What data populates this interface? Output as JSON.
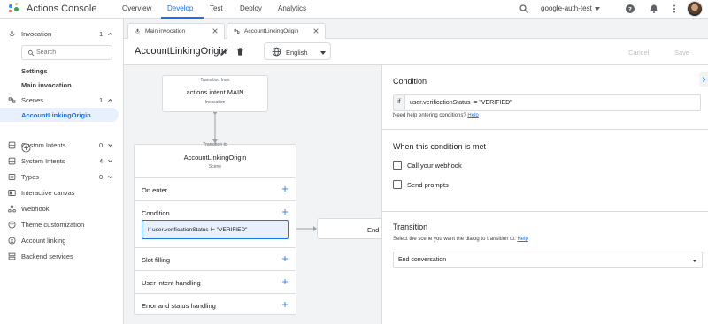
{
  "app": {
    "title": "Actions Console",
    "nav": [
      "Overview",
      "Develop",
      "Test",
      "Deploy",
      "Analytics"
    ],
    "active_nav": "Develop",
    "project": "google-auth-test",
    "colors": {
      "accent": "#1a73e8",
      "selected_bg": "#e8f0fe",
      "canvas_bg": "#f1f3f4"
    }
  },
  "sidebar": {
    "invocation": {
      "label": "Invocation",
      "count": "1"
    },
    "search_placeholder": "Search",
    "settings": "Settings",
    "main_invocation": "Main invocation",
    "scenes": {
      "label": "Scenes",
      "count": "1"
    },
    "scene_item": "AccountLinkingOrigin",
    "items": [
      {
        "label": "Custom Intents",
        "count": "0",
        "icon": "grid-icon"
      },
      {
        "label": "System Intents",
        "count": "4",
        "icon": "grid-icon"
      },
      {
        "label": "Types",
        "count": "0",
        "icon": "list-icon"
      },
      {
        "label": "Interactive canvas",
        "icon": "canvas-icon"
      },
      {
        "label": "Webhook",
        "icon": "webhook-icon"
      },
      {
        "label": "Theme customization",
        "icon": "palette-icon"
      },
      {
        "label": "Account linking",
        "icon": "account-icon"
      },
      {
        "label": "Backend services",
        "icon": "backend-icon"
      }
    ]
  },
  "tabs": [
    {
      "label": "Main invocation",
      "icon": "mic-icon"
    },
    {
      "label": "AccountLinkingOrigin",
      "icon": "scene-icon"
    }
  ],
  "scene": {
    "title": "AccountLinkingOrigin",
    "language": "English",
    "cancel": "Cancel",
    "save": "Save"
  },
  "canvas": {
    "from_caption": "Transition from",
    "from_title": "actions.intent.MAIN",
    "from_sub": "Invocation",
    "to_caption": "Transition to",
    "to_title": "AccountLinkingOrigin",
    "to_sub": "Scene",
    "sections": [
      "On enter",
      "Condition",
      "Slot filling",
      "User intent handling",
      "Error and status handling"
    ],
    "condition_chip": "if user.verificationStatus != \"VERIFIED\"",
    "end_node": "End c"
  },
  "panel": {
    "condition_heading": "Condition",
    "condition_prefix": "if",
    "condition_value": "user.verificationStatus != \"VERIFIED\"",
    "condition_help": "Need help entering conditions?",
    "help_link": "Help",
    "when_heading": "When this condition is met",
    "call_webhook": "Call your webhook",
    "send_prompts": "Send prompts",
    "transition_heading": "Transition",
    "transition_help": "Select the scene you want the dialog to transition to.",
    "transition_value": "End conversation"
  }
}
